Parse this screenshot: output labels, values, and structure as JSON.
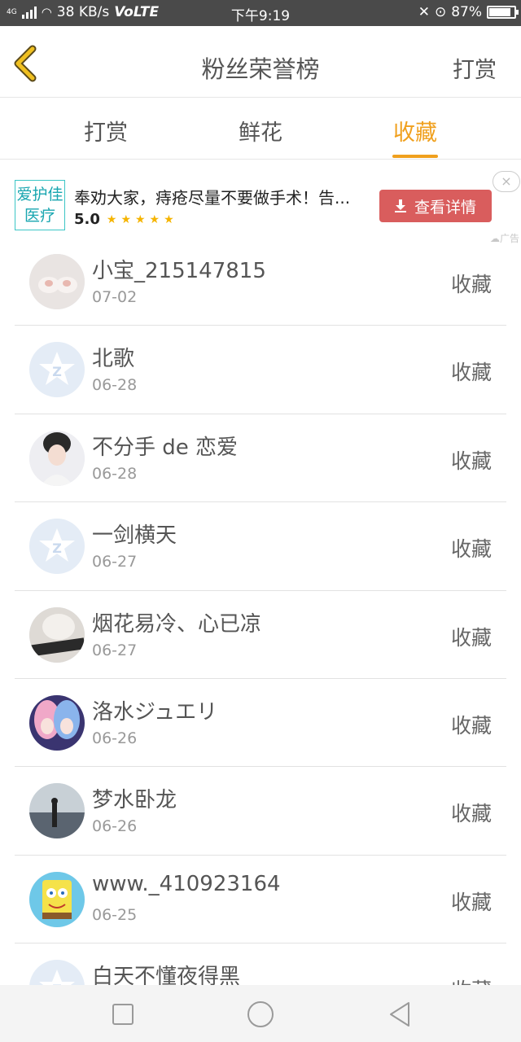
{
  "status_bar": {
    "network": "4G",
    "speed": "38 KB/s",
    "volte": "VoLTE",
    "time": "下午9:19",
    "battery": "87%",
    "battery_level": 0.87
  },
  "header": {
    "title": "粉丝荣誉榜",
    "action_label": "打赏",
    "accent": "#f0a01e"
  },
  "tabs": [
    {
      "label": "打赏",
      "active": false
    },
    {
      "label": "鲜花",
      "active": false
    },
    {
      "label": "收藏",
      "active": true
    }
  ],
  "ad": {
    "logo_line1": "爱护佳",
    "logo_line2": "医疗",
    "text": "奉劝大家，痔疮尽量不要做手术！告...",
    "rating": "5.0",
    "stars": "★★★★★",
    "cta_label": "查看详情",
    "close": "×",
    "label": "广告"
  },
  "list": [
    {
      "name": "小宝_215147815",
      "date": "07-02",
      "action": "收藏",
      "avatar": "photo-avatar"
    },
    {
      "name": "北歌",
      "date": "06-28",
      "action": "收藏",
      "avatar": "default-qq-avatar"
    },
    {
      "name": "不分手 de 恋爱",
      "date": "06-28",
      "action": "收藏",
      "avatar": "photo-avatar"
    },
    {
      "name": "一剑横天",
      "date": "06-27",
      "action": "收藏",
      "avatar": "default-qq-avatar"
    },
    {
      "name": "烟花易冷、心已凉",
      "date": "06-27",
      "action": "收藏",
      "avatar": "photo-avatar"
    },
    {
      "name": "洛水ジュエリ",
      "date": "06-26",
      "action": "收藏",
      "avatar": "photo-avatar"
    },
    {
      "name": "梦水卧龙",
      "date": "06-26",
      "action": "收藏",
      "avatar": "photo-avatar"
    },
    {
      "name": "www._410923164",
      "date": "06-25",
      "action": "收藏",
      "avatar": "photo-avatar"
    },
    {
      "name": "白天不懂夜得黑",
      "date": "",
      "action": "收藏",
      "avatar": "default-qq-avatar"
    }
  ],
  "nav": [
    "recent-apps-icon",
    "home-icon",
    "back-icon"
  ]
}
